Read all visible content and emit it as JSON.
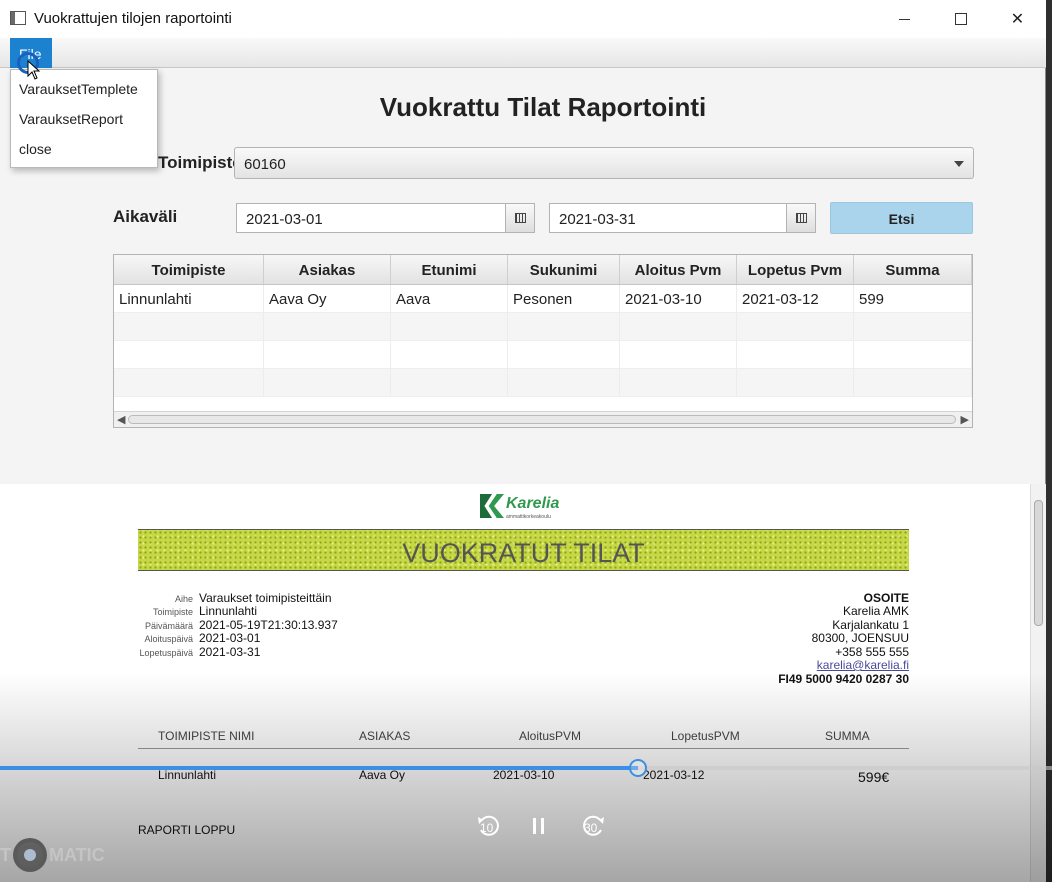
{
  "window": {
    "title": "Vuokrattujen tilojen raportointi",
    "controls": {
      "minimize": "—",
      "maximize": "☐",
      "close": "✕"
    }
  },
  "menubar": {
    "file_label": "File"
  },
  "file_menu": {
    "items": [
      "VarauksetTemplete",
      "VarauksetReport",
      "close"
    ]
  },
  "form": {
    "title": "Vuokrattu Tilat Raportointi",
    "toimipiste_label": "Toimipiste",
    "toimipiste_value": "60160",
    "aikavali_label": "Aikaväli",
    "date_start": "2021-03-01",
    "date_end": "2021-03-31",
    "search_label": "Etsi",
    "search_color": "#a9d4ec"
  },
  "table": {
    "columns": [
      "Toimipiste",
      "Asiakas",
      "Etunimi",
      "Sukunimi",
      "Aloitus Pvm",
      "Lopetus Pvm",
      "Summa"
    ],
    "rows": [
      [
        "Linnunlahti",
        "Aava Oy",
        "Aava",
        "Pesonen",
        "2021-03-10",
        "2021-03-12",
        "599"
      ]
    ]
  },
  "report": {
    "logo_name": "Karelia",
    "logo_sub": "ammattikorkeakoulu",
    "logo_color": "#2f9a4e",
    "banner": "VUOKRATUT TILAT",
    "banner_color": "#c7d846",
    "meta": [
      {
        "label": "Aihe",
        "value": "Varaukset toimipisteittäin"
      },
      {
        "label": "Toimipiste",
        "value": "Linnunlahti"
      },
      {
        "label": "Päivämäärä",
        "value": "2021-05-19T21:30:13.937"
      },
      {
        "label": "Aloituspäivä",
        "value": "2021-03-01"
      },
      {
        "label": "Lopetuspäivä",
        "value": "2021-03-31"
      }
    ],
    "address": {
      "heading": "OSOITE",
      "lines": [
        "Karelia AMK",
        "Karjalankatu 1",
        "80300, JOENSUU",
        "+358 555 555"
      ],
      "email": "karelia@karelia.fi",
      "iban": "FI49 5000 9420 0287 30"
    },
    "columns": [
      "TOIMIPISTE NIMI",
      "ASIAKAS",
      "AloitusPVM",
      "LopetusPVM",
      "SUMMA"
    ],
    "row": [
      "Linnunlahti",
      "Aava Oy",
      "2021-03-10",
      "2021-03-12",
      "599€"
    ],
    "footer": "RAPORTI LOPPU"
  },
  "player": {
    "progress": 0.606,
    "accent": "#3b8fe6",
    "rewind_label": "10",
    "forward_label": "30",
    "watermark_left": "T",
    "watermark_right": "MATIC"
  }
}
